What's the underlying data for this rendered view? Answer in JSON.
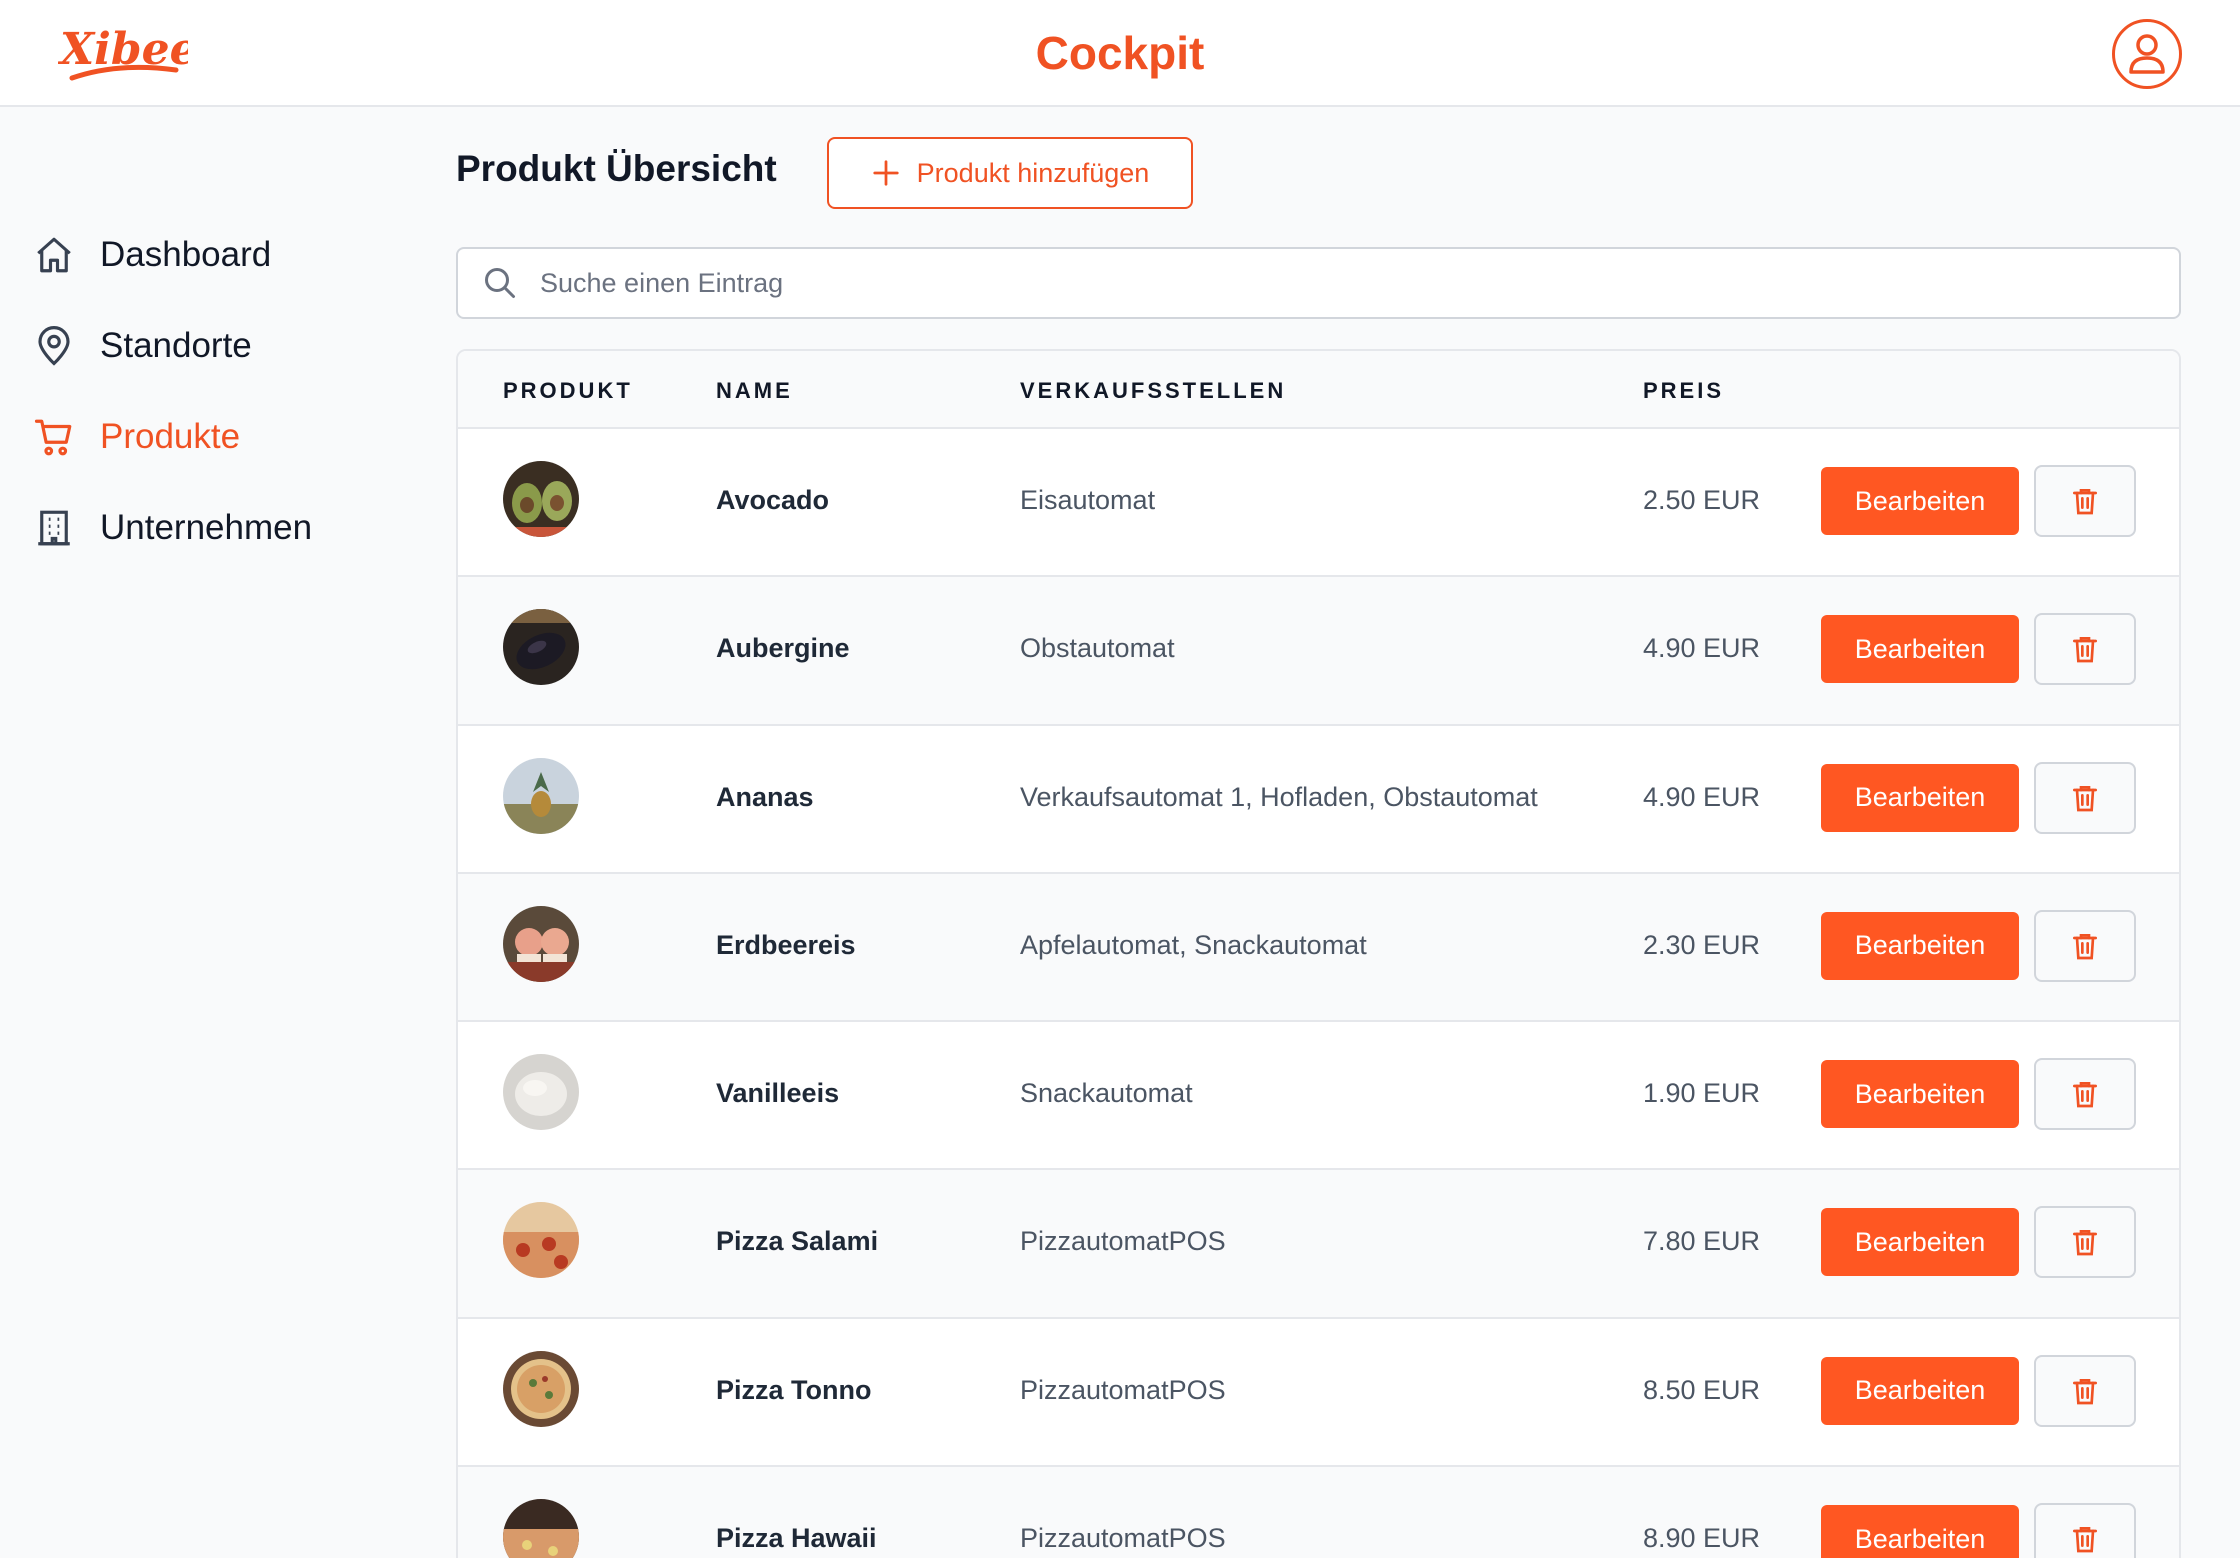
{
  "brand": {
    "logo_text": "Xibee",
    "app_title": "Cockpit",
    "accent_color": "#f05223",
    "button_color": "#ff5722"
  },
  "header": {
    "profile_icon": "user-circle-icon"
  },
  "sidebar": {
    "items": [
      {
        "label": "Dashboard",
        "icon": "home-icon",
        "active": false
      },
      {
        "label": "Standorte",
        "icon": "map-pin-icon",
        "active": false
      },
      {
        "label": "Produkte",
        "icon": "shopping-cart-icon",
        "active": true
      },
      {
        "label": "Unternehmen",
        "icon": "building-icon",
        "active": false
      }
    ]
  },
  "main": {
    "title": "Produkt Übersicht",
    "add_button_label": "Produkt hinzufügen",
    "search_placeholder": "Suche einen Eintrag"
  },
  "table": {
    "columns": [
      "PRODUKT",
      "NAME",
      "VERKAUFSSTELLEN",
      "PREIS"
    ],
    "edit_label": "Bearbeiten",
    "rows": [
      {
        "name": "Avocado",
        "stores": "Eisautomat",
        "price": "2.50 EUR",
        "thumb": "avocado"
      },
      {
        "name": "Aubergine",
        "stores": "Obstautomat",
        "price": "4.90 EUR",
        "thumb": "aubergine"
      },
      {
        "name": "Ananas",
        "stores": "Verkaufsautomat 1, Hofladen, Obstautomat",
        "price": "4.90 EUR",
        "thumb": "ananas"
      },
      {
        "name": "Erdbeereis",
        "stores": "Apfelautomat, Snackautomat",
        "price": "2.30 EUR",
        "thumb": "erdbeereis"
      },
      {
        "name": "Vanilleeis",
        "stores": "Snackautomat",
        "price": "1.90 EUR",
        "thumb": "vanilleeis"
      },
      {
        "name": "Pizza Salami",
        "stores": "PizzautomatPOS",
        "price": "7.80 EUR",
        "thumb": "pizza-salami"
      },
      {
        "name": "Pizza Tonno",
        "stores": "PizzautomatPOS",
        "price": "8.50 EUR",
        "thumb": "pizza-tonno"
      },
      {
        "name": "Pizza Hawaii",
        "stores": "PizzautomatPOS",
        "price": "8.90 EUR",
        "thumb": "pizza-hawaii"
      }
    ]
  }
}
